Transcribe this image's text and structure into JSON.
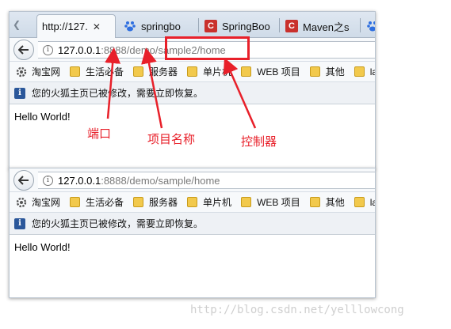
{
  "window1": {
    "tabs": [
      {
        "title": "http://127.",
        "active": true,
        "icon": "none"
      },
      {
        "title": "springbo",
        "icon": "baidu-paw-icon"
      },
      {
        "title": "SpringBoo",
        "icon": "csdn-icon"
      },
      {
        "title": "Maven之s",
        "icon": "csdn-icon"
      }
    ],
    "url": {
      "host": "127.0.0.1",
      "rest": ":8888/demo/sample2/home"
    },
    "bookmarks": [
      "淘宝网",
      "生活必备",
      "服务器",
      "单片机",
      "WEB 项目",
      "其他",
      "layu"
    ],
    "notice": "您的火狐主页已被修改，需要立即恢复。",
    "content": "Hello World!"
  },
  "window2": {
    "url": {
      "host": "127.0.0.1",
      "rest": ":8888/demo/sample/home"
    },
    "bookmarks": [
      "淘宝网",
      "生活必备",
      "服务器",
      "单片机",
      "WEB 项目",
      "其他",
      "layu"
    ],
    "notice": "您的火狐主页已被修改，需要立即恢复。",
    "content": "Hello World!"
  },
  "annotations": {
    "port": "端口",
    "project_name": "项目名称",
    "controller": "控制器"
  },
  "colors": {
    "annotation": "#e8202a",
    "tabstrip": "#d6e0eb",
    "folder": "#f2c94c"
  },
  "watermark": "http://blog.csdn.net/yelllowcong"
}
